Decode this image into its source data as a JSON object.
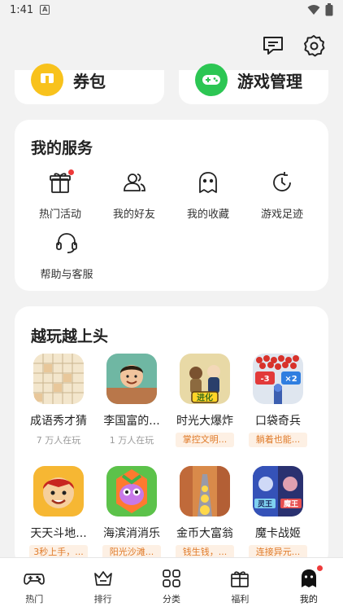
{
  "status_bar": {
    "time": "1:41",
    "notification_badge": "A"
  },
  "header": {
    "message_icon": "message-icon",
    "settings_icon": "gear-icon"
  },
  "top_cards": [
    {
      "label": "券包",
      "icon": "coupon-icon",
      "color": "#f8c21c"
    },
    {
      "label": "游戏管理",
      "icon": "gamepad-icon",
      "color": "#2cc653"
    }
  ],
  "services": {
    "title": "我的服务",
    "items": [
      {
        "label": "热门活动",
        "icon": "gift-icon",
        "badge": true
      },
      {
        "label": "我的好友",
        "icon": "friends-icon"
      },
      {
        "label": "我的收藏",
        "icon": "ghost-icon"
      },
      {
        "label": "游戏足迹",
        "icon": "history-icon"
      },
      {
        "label": "帮助与客服",
        "icon": "headset-icon"
      }
    ]
  },
  "games": {
    "title": "越玩越上头",
    "items": [
      {
        "name": "成语秀才猜",
        "sub": "7 万人在玩"
      },
      {
        "name": "李国富的...",
        "sub": "1 万人在玩"
      },
      {
        "name": "时光大爆炸",
        "tag": "掌控文明..."
      },
      {
        "name": "口袋奇兵",
        "tag": "躺着也能..."
      },
      {
        "name": "天天斗地...",
        "tag": "3秒上手，..."
      },
      {
        "name": "海滨消消乐",
        "tag": "阳光沙滩..."
      },
      {
        "name": "金币大富翁",
        "tag": "钱生钱，..."
      },
      {
        "name": "魔卡战姬",
        "tag": "连接异元..."
      }
    ],
    "thumb_texts": {
      "evolve": "进化",
      "minus3": "-3",
      "times2": "×2",
      "king1": "灵王",
      "king2": "魔王"
    }
  },
  "bottom_nav": [
    {
      "label": "热门",
      "icon": "gamepad-nav-icon"
    },
    {
      "label": "排行",
      "icon": "crown-icon"
    },
    {
      "label": "分类",
      "icon": "grid-icon"
    },
    {
      "label": "福利",
      "icon": "gift-nav-icon"
    },
    {
      "label": "我的",
      "icon": "ghost-nav-icon",
      "active": true,
      "badge": true
    }
  ],
  "colors": {
    "accent_red": "#ee3a3a",
    "tag_orange": "#e07b2a",
    "tag_bg": "#fdf0e4"
  }
}
